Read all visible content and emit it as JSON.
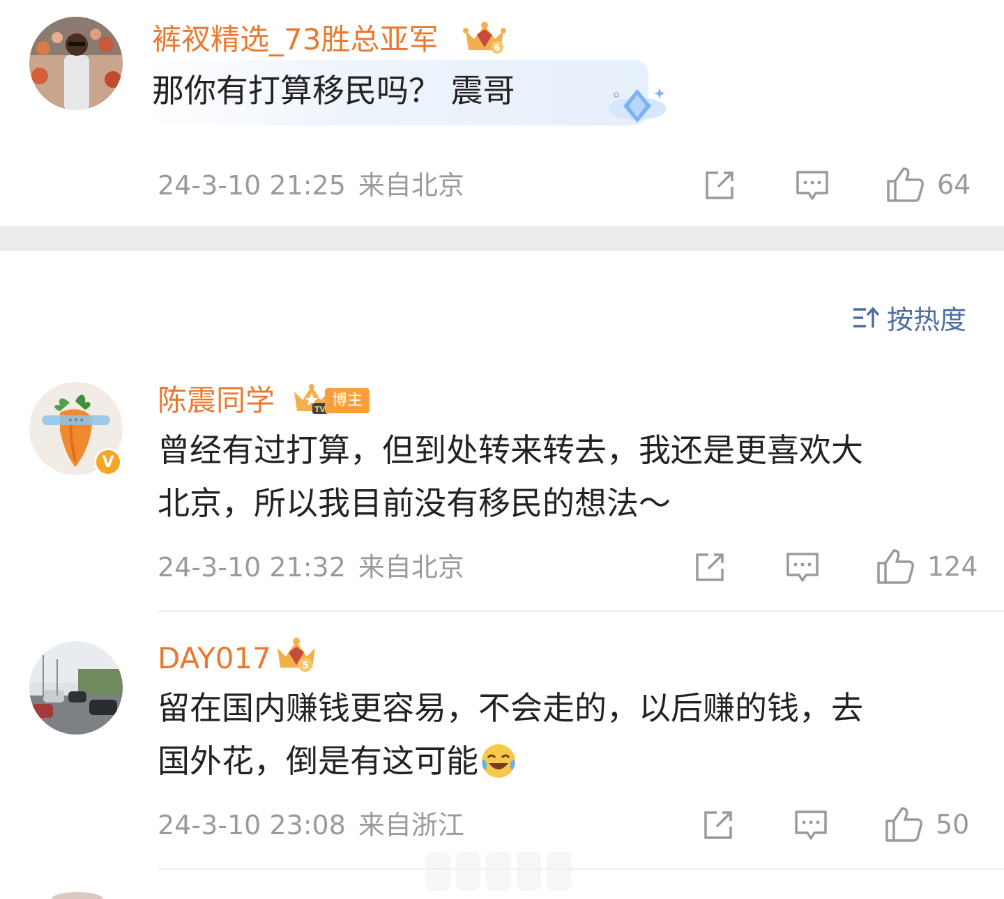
{
  "comments": [
    {
      "username": "裤衩精选_73胜总亚军",
      "text": "那你有打算移民吗？ 震哥",
      "time": "24-3-10 21:25",
      "location": "来自北京",
      "likes": "64",
      "badge": "crown-level-6-icon"
    },
    {
      "username": "陈震同学",
      "blogger_tag": "博主",
      "text_lines": [
        "曾经有过打算，但到处转来转去，我还是更喜欢大",
        "北京，所以我目前没有移民的想法～"
      ],
      "time": "24-3-10 21:32",
      "location": "来自北京",
      "likes": "124",
      "badge": "crown-tv-icon",
      "verified": "V"
    },
    {
      "username": "DAY017",
      "text_lines": [
        "留在国内赚钱更容易，不会走的，以后赚的钱，去",
        "国外花，倒是有这可能"
      ],
      "emoji": "laugh-cry-emoji",
      "time": "24-3-10 23:08",
      "location": "来自浙江",
      "likes": "50",
      "badge": "crown-level-5-icon"
    }
  ],
  "sort": {
    "label": "按热度",
    "icon": "sort-icon"
  },
  "colors": {
    "username": "#e8792f",
    "meta": "#9a9a9a",
    "sort": "#4a6ea0",
    "text": "#222222"
  }
}
